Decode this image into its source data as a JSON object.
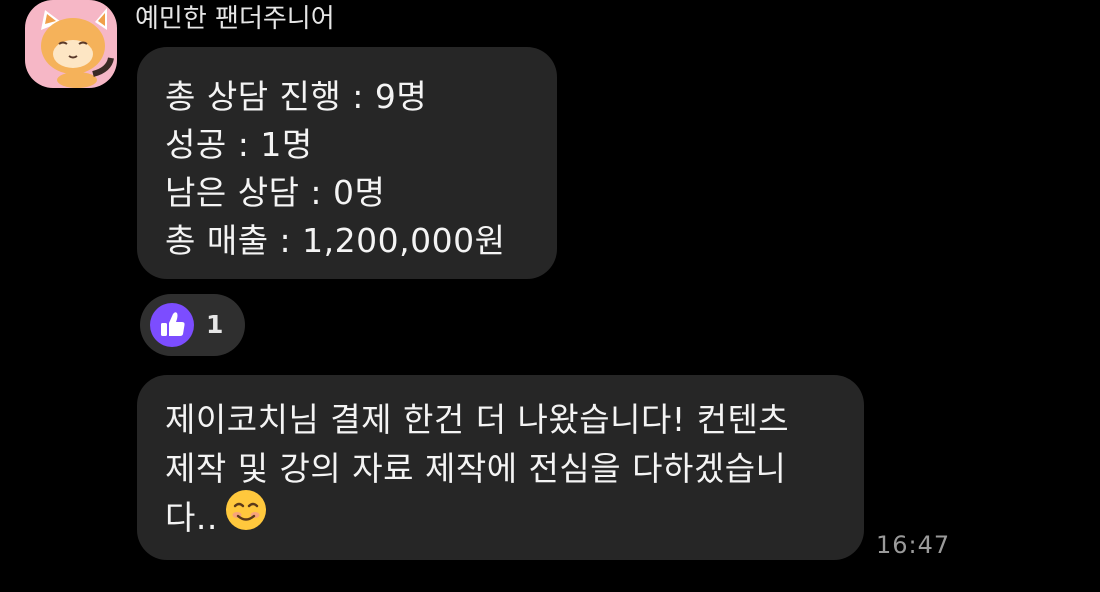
{
  "sender": {
    "name": "예민한 팬더주니어",
    "avatar_icon": "red-panda-avatar-icon"
  },
  "messages": [
    {
      "lines": [
        "총 상담 진행 : 9명",
        "성공 : 1명",
        "남은 상담 : 0명",
        "총 매출 : 1,200,000원"
      ]
    },
    {
      "lines": [
        "제이코치님 결제 한건 더 나왔습니다! 컨텐츠",
        "제작 및 강의 자료 제작에 전심을 다하겠습니",
        "다.."
      ],
      "trailing_emoji": "smiling-face-emoji"
    }
  ],
  "reaction": {
    "icon": "thumbs-up-icon",
    "count": "1",
    "color": "#7c4dff"
  },
  "timestamp": "16:47",
  "colors": {
    "background": "#000000",
    "bubble": "#262626",
    "avatar_bg": "#f6b7c6"
  }
}
